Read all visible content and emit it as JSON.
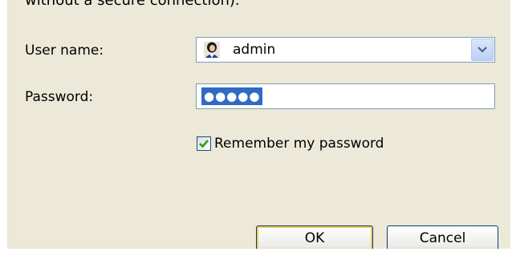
{
  "dialog": {
    "cutoff_text": "without a secure connection)."
  },
  "username": {
    "label": "User name:",
    "value": "admin",
    "icon": "user-account-icon"
  },
  "password": {
    "label": "Password:",
    "masked_value": "●●●●●"
  },
  "remember": {
    "label": "Remember my password",
    "checked": true
  },
  "buttons": {
    "ok_label": "OK",
    "cancel_label": "Cancel"
  },
  "colors": {
    "dialog_bg": "#ece9d8",
    "selection": "#316ac5",
    "field_border": "#7f9db9",
    "check_green": "#21a121"
  }
}
